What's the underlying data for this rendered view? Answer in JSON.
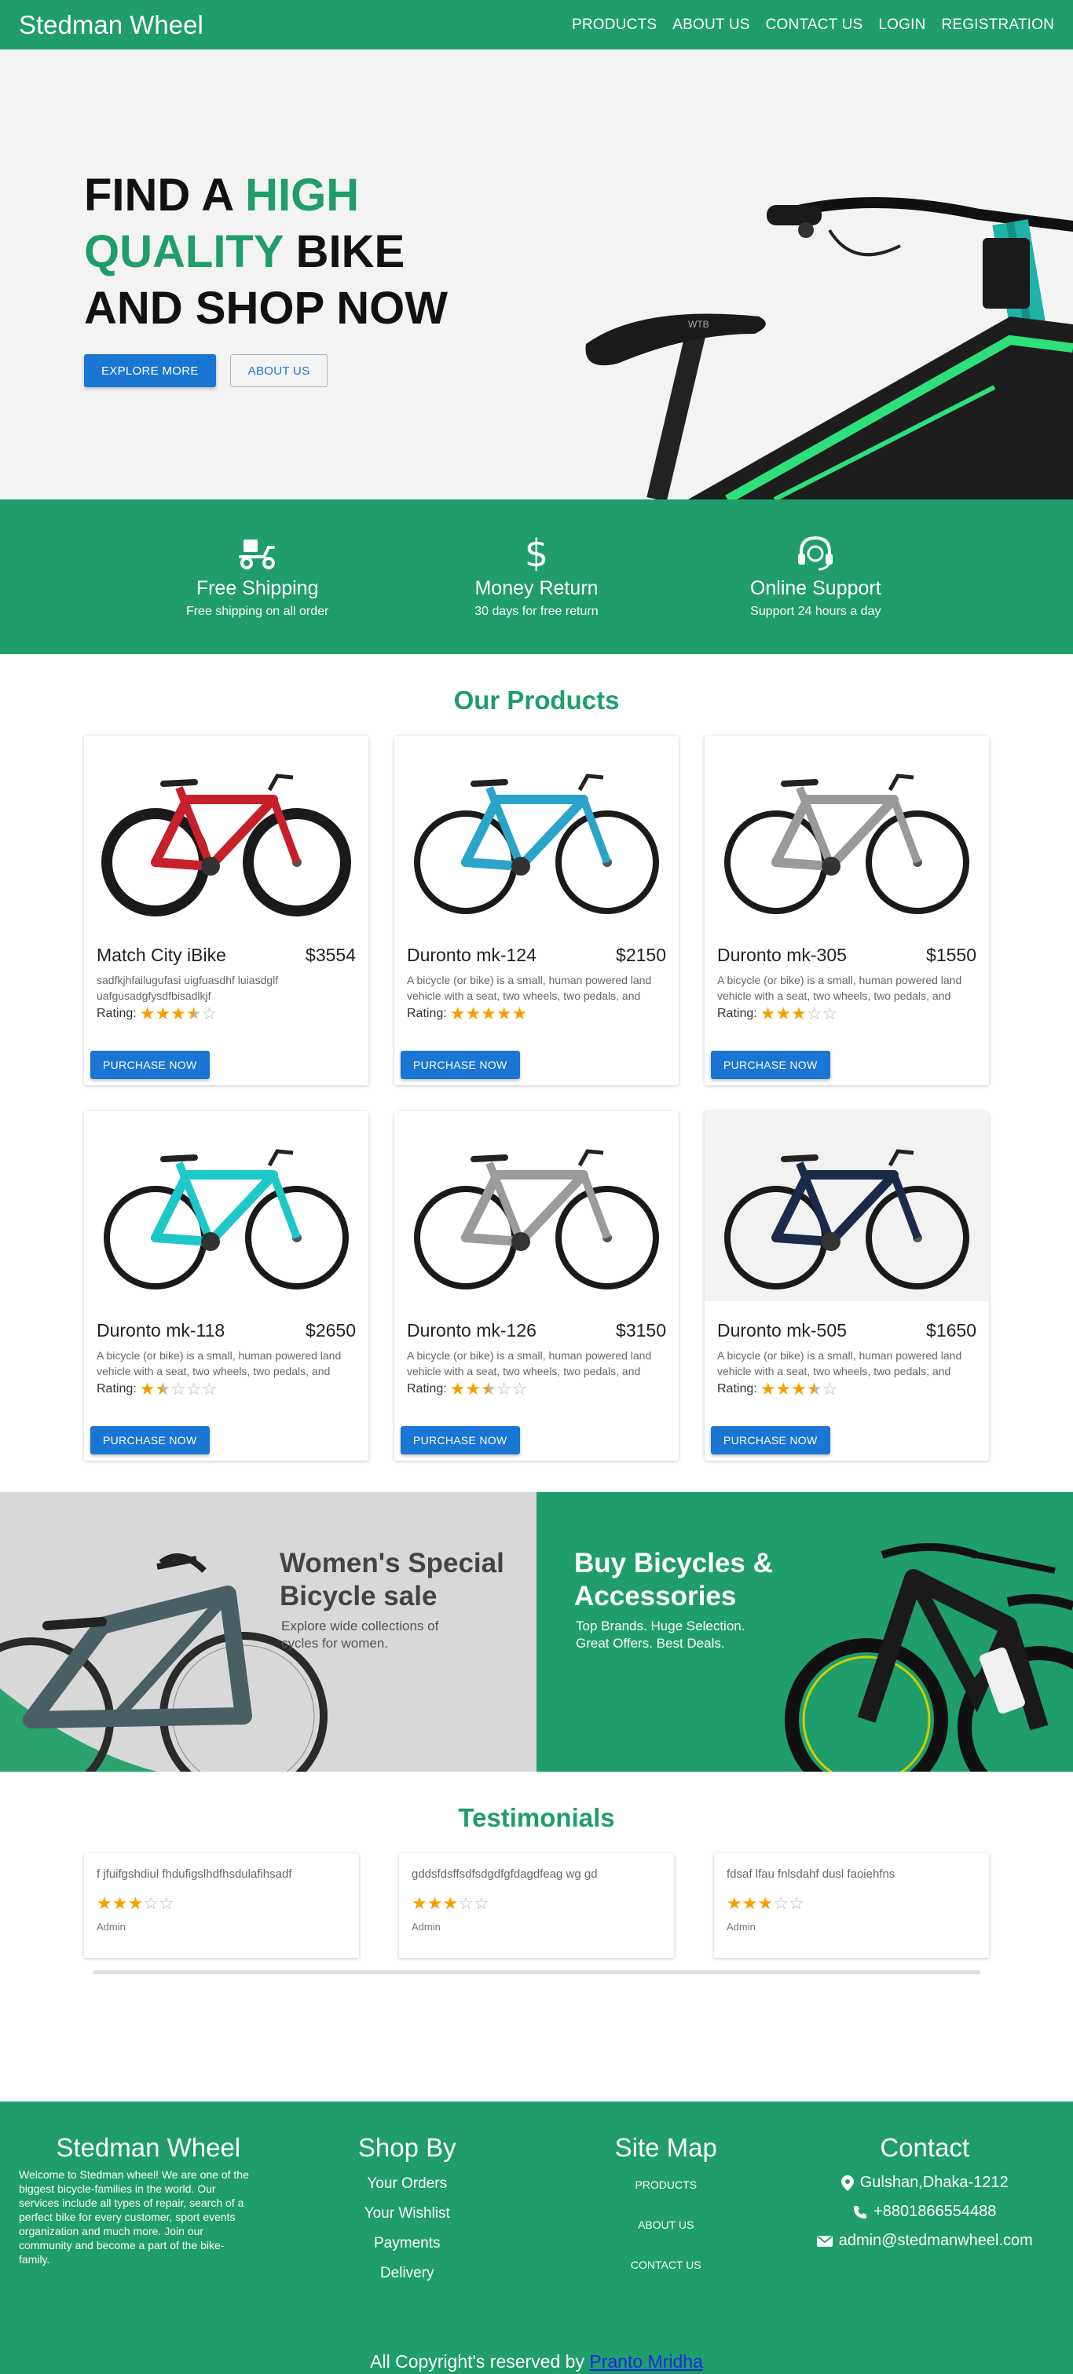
{
  "brand": {
    "name": "Stedman Wheel"
  },
  "nav": {
    "items": [
      "PRODUCTS",
      "ABOUT US",
      "CONTACT US",
      "LOGIN",
      "REGISTRATION"
    ]
  },
  "hero": {
    "title_part1": "FIND A ",
    "title_highlight1": "HIGH",
    "title_highlight2": "QUALITY",
    "title_part2": " BIKE",
    "title_part3": "AND SHOP NOW",
    "explore_label": "EXPLORE MORE",
    "about_label": "ABOUT US"
  },
  "features": [
    {
      "icon": "delivery-scooter-icon",
      "title": "Free Shipping",
      "sub": "Free shipping on all order"
    },
    {
      "icon": "dollar-icon",
      "title": "Money Return",
      "sub": "30 days for free return"
    },
    {
      "icon": "headset-icon",
      "title": "Online Support",
      "sub": "Support 24 hours a day"
    }
  ],
  "products": {
    "title": "Our Products",
    "rating_label": "Rating:",
    "purchase_label": "PURCHASE NOW",
    "items": [
      {
        "name": "Match City iBike",
        "price": "$3554",
        "desc": "sadfkjhfailugufasi uigfuasdhf luiasdglf uafgusadgfysdfbisadlkjf",
        "rating": 3.5,
        "frame": "#c8202a"
      },
      {
        "name": "Duronto mk-124",
        "price": "$2150",
        "desc": "A bicycle (or bike) is a small, human powered land vehicle with a seat, two wheels, two pedals, and",
        "rating": 5,
        "frame": "#2aa5c9"
      },
      {
        "name": "Duronto mk-305",
        "price": "$1550",
        "desc": "A bicycle (or bike) is a small, human powered land vehicle with a seat, two wheels, two pedals, and",
        "rating": 3,
        "frame": "#9a9a9a"
      },
      {
        "name": "Duronto mk-118",
        "price": "$2650",
        "desc": "A bicycle (or bike) is a small, human powered land vehicle with a seat, two wheels, two pedals, and",
        "rating": 1.5,
        "frame": "#1ec8c8"
      },
      {
        "name": "Duronto mk-126",
        "price": "$3150",
        "desc": "A bicycle (or bike) is a small, human powered land vehicle with a seat, two wheels, two pedals, and",
        "rating": 2.5,
        "frame": "#9b9b9b"
      },
      {
        "name": "Duronto mk-505",
        "price": "$1650",
        "desc": "A bicycle (or bike) is a small, human powered land vehicle with a seat, two wheels, two pedals, and",
        "rating": 3.5,
        "frame": "#1c2a4a"
      }
    ]
  },
  "banners": {
    "left_title_1": "Women's Special",
    "left_title_2": "Bicycle sale",
    "left_sub_1": "Explore wide collections of",
    "left_sub_2": "cycles for women.",
    "right_title_1": "Buy Bicycles &",
    "right_title_2": "Accessories",
    "right_sub_1": "Top Brands. Huge Selection.",
    "right_sub_2": "Great Offers. Best Deals."
  },
  "testimonials": {
    "title": "Testimonials",
    "items": [
      {
        "text": "f jfuifgshdiul fhdufigslhdfhsdulafihsadf",
        "rating": 3,
        "author": "Admin"
      },
      {
        "text": "gddsfdsffsdfsdgdfgfdagdfeag wg gd",
        "rating": 3,
        "author": "Admin"
      },
      {
        "text": "fdsaf lfau fnlsdahf dusl faoiehfns",
        "rating": 3,
        "author": "Admin"
      }
    ]
  },
  "footer": {
    "brand": "Stedman Wheel",
    "about": "Welcome to Stedman wheel! We are one of the biggest bicycle-families in the world. Our services include all types of repair, search of a perfect bike for every customer, sport events organization and much more. Join our community and become a part of the bike-family.",
    "shop_title": "Shop By",
    "shop_links": [
      "Your Orders",
      "Your Wishlist",
      "Payments",
      "Delivery"
    ],
    "site_title": "Site Map",
    "site_links": [
      "PRODUCTS",
      "ABOUT US",
      "CONTACT US"
    ],
    "contact_title": "Contact",
    "address": "Gulshan,Dhaka-1212",
    "phone": "+8801866554488",
    "email": "admin@stedmanwheel.com",
    "copyright": "All Copyright's reserved by ",
    "author_link": "Pranto Mridha"
  },
  "colors": {
    "brand_green": "#1f9d6b",
    "primary_blue": "#1976d2",
    "star": "#f4a000"
  }
}
